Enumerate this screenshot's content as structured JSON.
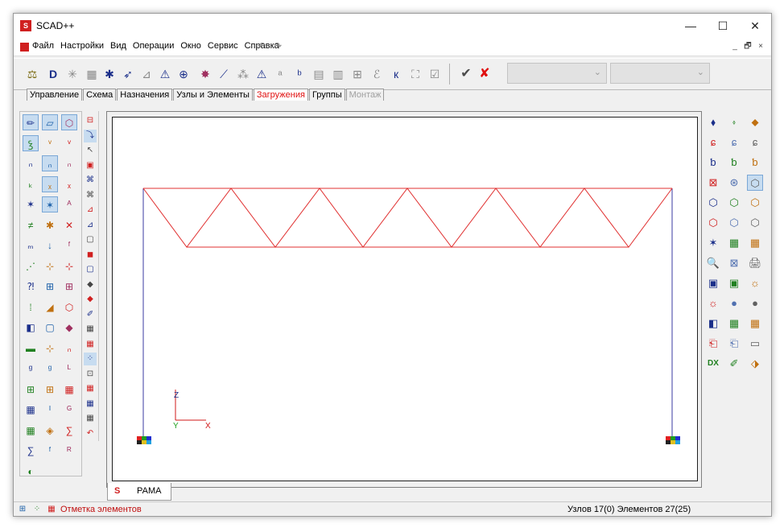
{
  "window": {
    "title": "SCAD++",
    "minimize": "—",
    "maximize": "☐",
    "close": "✕"
  },
  "menu": {
    "items": [
      "Файл",
      "Настройки",
      "Вид",
      "Операции",
      "Окно",
      "Сервис",
      "Справка"
    ],
    "undo": "↶",
    "redo": "↷",
    "mdi_minimize": "_",
    "mdi_restore": "🗗",
    "mdi_close": "×"
  },
  "toolbar": {
    "icons": [
      "⚖",
      "D",
      "✳",
      "▦",
      "✱",
      "➶",
      "⊿",
      "⚠",
      "⊕",
      "✸",
      "⟋",
      "⁂",
      "⚠",
      "ᵃ",
      "ᵇ",
      "▤",
      "▥",
      "⊞",
      "ℰ",
      "к",
      "⛶",
      "☑"
    ],
    "check": "✔",
    "cancel": "✘",
    "combo1": "",
    "combo2": ""
  },
  "tabs": [
    {
      "label": "Управление",
      "state": "normal"
    },
    {
      "label": "Схема",
      "state": "normal"
    },
    {
      "label": "Назначения",
      "state": "normal"
    },
    {
      "label": "Узлы и Элементы",
      "state": "normal"
    },
    {
      "label": "Загружения",
      "state": "active"
    },
    {
      "label": "Группы",
      "state": "normal"
    },
    {
      "label": "Монтаж",
      "state": "disabled"
    }
  ],
  "left_panel": {
    "icons": [
      "✏",
      "▱",
      "⬡",
      "ꝣ",
      "ᵛ",
      "ᵛ",
      "ₙ",
      "ₙ",
      "ₙ",
      "ₖ",
      "ₓ",
      "ₓ",
      "✶",
      "✶",
      "ᴬ",
      "≠",
      "✱",
      "✕",
      "ₘ",
      "↓",
      "ᶠ",
      "⋰",
      "⊹",
      "⊹",
      "⁈",
      "⊞",
      "⊞",
      "⁞",
      "◢",
      "⬡",
      "◧",
      "▢",
      "◆",
      "▬",
      "⊹",
      "ₙ",
      "ᵍ",
      "ᵍ",
      "ᴸ",
      "⊞",
      "⊞",
      "▦",
      "▦",
      "ᴵ",
      "ᴳ",
      "▦",
      "◈",
      "∑",
      "∑",
      "ᶠ",
      "ᴿ",
      "◐"
    ]
  },
  "left2_panel": {
    "icons": [
      "⊟",
      "⤵",
      "↖",
      "▣",
      "⌘",
      "⌘",
      "⊿",
      "⊿",
      "▢",
      "◼",
      "▢",
      "◆",
      "◆",
      "✐",
      "▦",
      "▦",
      "⁘",
      "⊡",
      "▦",
      "▦",
      "▦",
      "↶"
    ]
  },
  "right_panel": {
    "icons": [
      "⬧",
      "⬫",
      "⬥",
      "ɕ",
      "ɕ",
      "ɕ",
      "ƅ",
      "ƅ",
      "ƅ",
      "⊠",
      "⊛",
      "⬡",
      "⬡",
      "⬡",
      "⬡",
      "⬡",
      "⬡",
      "⬡",
      "✶",
      "▦",
      "▦",
      "🔍",
      "⊠",
      "🖨",
      "▣",
      "▣",
      "☼",
      "☼",
      "●",
      "●",
      "◧",
      "▦",
      "▦",
      "⎗",
      "⎗",
      "▭",
      "DX",
      "✐",
      "⬗"
    ]
  },
  "canvas": {
    "axis_z": "Z",
    "axis_y": "Y",
    "axis_x": "X",
    "colors": {
      "truss": "#e03030",
      "columns": "#3a3aa0",
      "axes": "#d01818"
    }
  },
  "doc_tab": {
    "label": "РАМА",
    "logo": "S"
  },
  "status": {
    "left_text": "Отметка элементов",
    "right_text": "Узлов 17(0) Элементов 27(25)"
  }
}
